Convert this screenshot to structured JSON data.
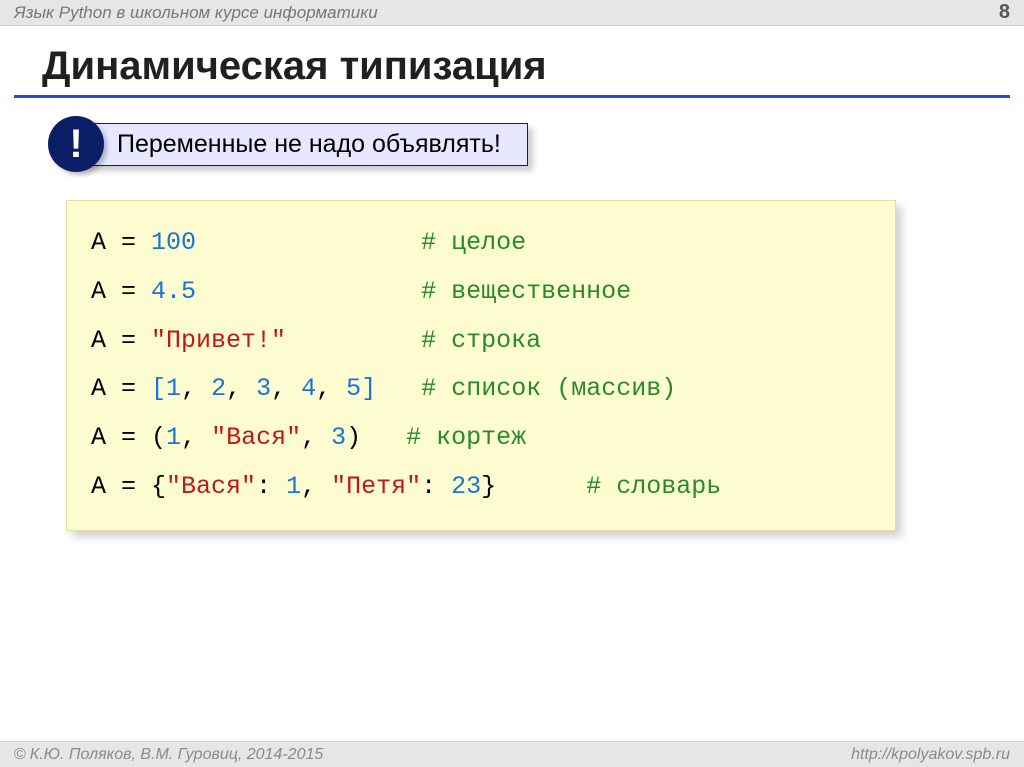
{
  "header": {
    "course": "Язык Python в школьном курсе информатики",
    "page": "8"
  },
  "title": "Динамическая типизация",
  "callout": {
    "badge": "!",
    "text": "Переменные не надо объявлять!"
  },
  "code": {
    "lines": [
      {
        "var": "A",
        "assign": " = ",
        "value_tokens": [
          {
            "t": "num",
            "v": "100"
          }
        ],
        "pad": "               ",
        "comment": "# целое"
      },
      {
        "var": "A",
        "assign": " = ",
        "value_tokens": [
          {
            "t": "num",
            "v": "4.5"
          }
        ],
        "pad": "               ",
        "comment": "# вещественное"
      },
      {
        "var": "A",
        "assign": " = ",
        "value_tokens": [
          {
            "t": "str",
            "v": "\"Привет!\""
          }
        ],
        "pad": "         ",
        "comment": "# строка"
      },
      {
        "var": "A",
        "assign": " = ",
        "value_tokens": [
          {
            "t": "brk",
            "v": "["
          },
          {
            "t": "num",
            "v": "1"
          },
          {
            "t": "pun",
            "v": ", "
          },
          {
            "t": "num",
            "v": "2"
          },
          {
            "t": "pun",
            "v": ", "
          },
          {
            "t": "num",
            "v": "3"
          },
          {
            "t": "pun",
            "v": ", "
          },
          {
            "t": "num",
            "v": "4"
          },
          {
            "t": "pun",
            "v": ", "
          },
          {
            "t": "num",
            "v": "5"
          },
          {
            "t": "brk",
            "v": "]"
          }
        ],
        "pad": "   ",
        "comment": "# список (массив)"
      },
      {
        "var": "A",
        "assign": " = ",
        "value_tokens": [
          {
            "t": "pun",
            "v": "("
          },
          {
            "t": "num",
            "v": "1"
          },
          {
            "t": "pun",
            "v": ", "
          },
          {
            "t": "str",
            "v": "\"Вася\""
          },
          {
            "t": "pun",
            "v": ", "
          },
          {
            "t": "num",
            "v": "3"
          },
          {
            "t": "pun",
            "v": ")"
          }
        ],
        "pad": "   ",
        "comment": "# кортеж"
      },
      {
        "var": "A",
        "assign": " = ",
        "value_tokens": [
          {
            "t": "pun",
            "v": "{"
          },
          {
            "t": "str",
            "v": "\"Вася\""
          },
          {
            "t": "pun",
            "v": ": "
          },
          {
            "t": "num",
            "v": "1"
          },
          {
            "t": "pun",
            "v": ", "
          },
          {
            "t": "str",
            "v": "\"Петя\""
          },
          {
            "t": "pun",
            "v": ": "
          },
          {
            "t": "num",
            "v": "23"
          },
          {
            "t": "pun",
            "v": "}"
          }
        ],
        "pad": "      ",
        "comment": "# словарь"
      }
    ]
  },
  "footer": {
    "copyright": "К.Ю. Поляков, В.М. Гуровиц, 2014-2015",
    "url": "http://kpolyakov.spb.ru"
  }
}
